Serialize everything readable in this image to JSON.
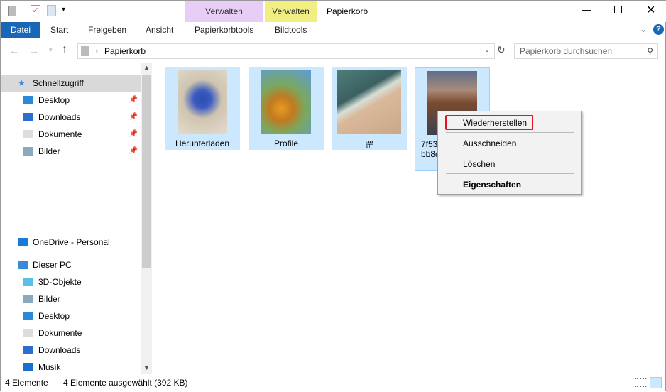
{
  "title": "Papierkorb",
  "quick_access": {
    "icons": [
      "recycle-bin-icon",
      "properties-icon",
      "new-folder-icon",
      "customize-icon"
    ]
  },
  "context_tabs": [
    {
      "label": "Verwalten",
      "color": "#e8cdf7"
    },
    {
      "label": "Verwalten",
      "color": "#f1ef82"
    }
  ],
  "ribbon": {
    "tabs": [
      "Datei",
      "Start",
      "Freigeben",
      "Ansicht",
      "Papierkorbtools",
      "Bildtools"
    ],
    "accent": "#1a67b5"
  },
  "address": {
    "path": "Papierkorb",
    "search_placeholder": "Papierkorb durchsuchen"
  },
  "sidebar": {
    "items": [
      {
        "label": "Schnellzugriff",
        "icon": "star-icon",
        "selected": true
      },
      {
        "label": "Desktop",
        "icon": "desktop-icon",
        "pinned": true
      },
      {
        "label": "Downloads",
        "icon": "download-icon",
        "pinned": true
      },
      {
        "label": "Dokumente",
        "icon": "document-icon",
        "pinned": true
      },
      {
        "label": "Bilder",
        "icon": "pictures-icon",
        "pinned": true
      },
      {
        "label": "OneDrive - Personal",
        "icon": "cloud-icon"
      },
      {
        "label": "Dieser PC",
        "icon": "pc-icon"
      },
      {
        "label": "3D-Objekte",
        "icon": "cube-icon"
      },
      {
        "label": "Bilder",
        "icon": "pictures-icon"
      },
      {
        "label": "Desktop",
        "icon": "desktop-icon"
      },
      {
        "label": "Dokumente",
        "icon": "document-icon"
      },
      {
        "label": "Downloads",
        "icon": "download-icon"
      },
      {
        "label": "Musik",
        "icon": "music-icon"
      }
    ]
  },
  "files": [
    {
      "name": "Herunterladen",
      "line2": ""
    },
    {
      "name": "Profile",
      "line2": ""
    },
    {
      "name": "罡",
      "line2": ""
    },
    {
      "name": "7f53e",
      "line2": "bb8d"
    }
  ],
  "context_menu": {
    "items": [
      "Wiederherstellen",
      "Ausschneiden",
      "Löschen",
      "Eigenschaften"
    ],
    "highlight_color": "#e81123"
  },
  "status": {
    "count": "4 Elemente",
    "selected": "4 Elemente ausgewählt (392 KB)"
  }
}
